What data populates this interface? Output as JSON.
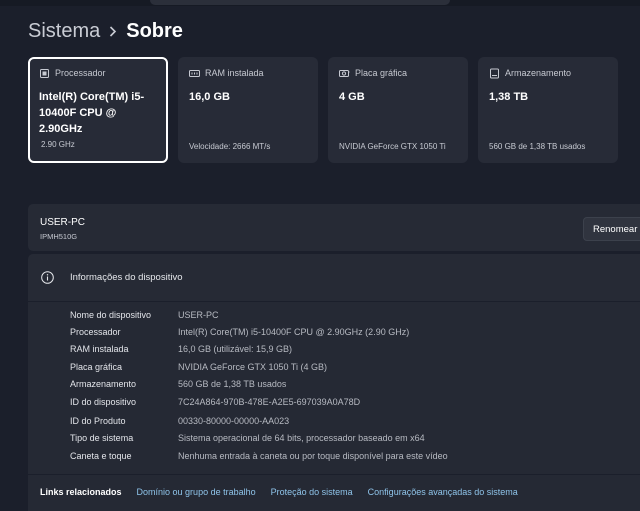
{
  "breadcrumb": {
    "parent": "Sistema",
    "current": "Sobre"
  },
  "cards": [
    {
      "label": "Processador",
      "icon": "processor-icon",
      "value": "Intel(R) Core(TM) i5-10400F CPU @ 2.90GHz",
      "sub": "2.90 GHz",
      "selected": true
    },
    {
      "label": "RAM instalada",
      "icon": "ram-icon",
      "value": "16,0 GB",
      "sub": "Velocidade: 2666 MT/s"
    },
    {
      "label": "Placa gráfica",
      "icon": "graphics-card-icon",
      "value": "4 GB",
      "sub": "NVIDIA GeForce GTX 1050 Ti"
    },
    {
      "label": "Armazenamento",
      "icon": "storage-icon",
      "value": "1,38 TB",
      "sub": "560 GB de 1,38 TB usados"
    }
  ],
  "device": {
    "name": "USER-PC",
    "model": "IPMH510G",
    "rename_label": "Renomear este PC"
  },
  "info": {
    "title": "Informações do dispositivo",
    "rows": [
      {
        "key": "Nome do dispositivo",
        "value": "USER-PC"
      },
      {
        "key": "Processador",
        "value": "Intel(R) Core(TM) i5-10400F CPU @ 2.90GHz (2.90 GHz)"
      },
      {
        "key": "RAM instalada",
        "value": "16,0 GB (utilizável: 15,9 GB)"
      },
      {
        "key": "Placa gráfica",
        "value": "NVIDIA GeForce GTX 1050 Ti (4 GB)"
      },
      {
        "key": "Armazenamento",
        "value": "560 GB de 1,38 TB usados"
      },
      {
        "key": "ID do dispositivo",
        "value": "7C24A864-970B-478E-A2E5-697039A0A78D"
      },
      {
        "key": "ID do Produto",
        "value": "00330-80000-00000-AA023"
      },
      {
        "key": "Tipo de sistema",
        "value": "Sistema operacional de 64 bits, processador baseado em x64"
      },
      {
        "key": "Caneta e toque",
        "value": "Nenhuma entrada à caneta ou por toque disponível para este vídeo"
      }
    ]
  },
  "links": {
    "title": "Links relacionados",
    "items": [
      "Domínio ou grupo de trabalho",
      "Proteção do sistema",
      "Configurações avançadas do sistema"
    ]
  },
  "colors": {
    "background": "#1b1f2b",
    "card": "#272b37",
    "link": "#8fc4ea"
  }
}
